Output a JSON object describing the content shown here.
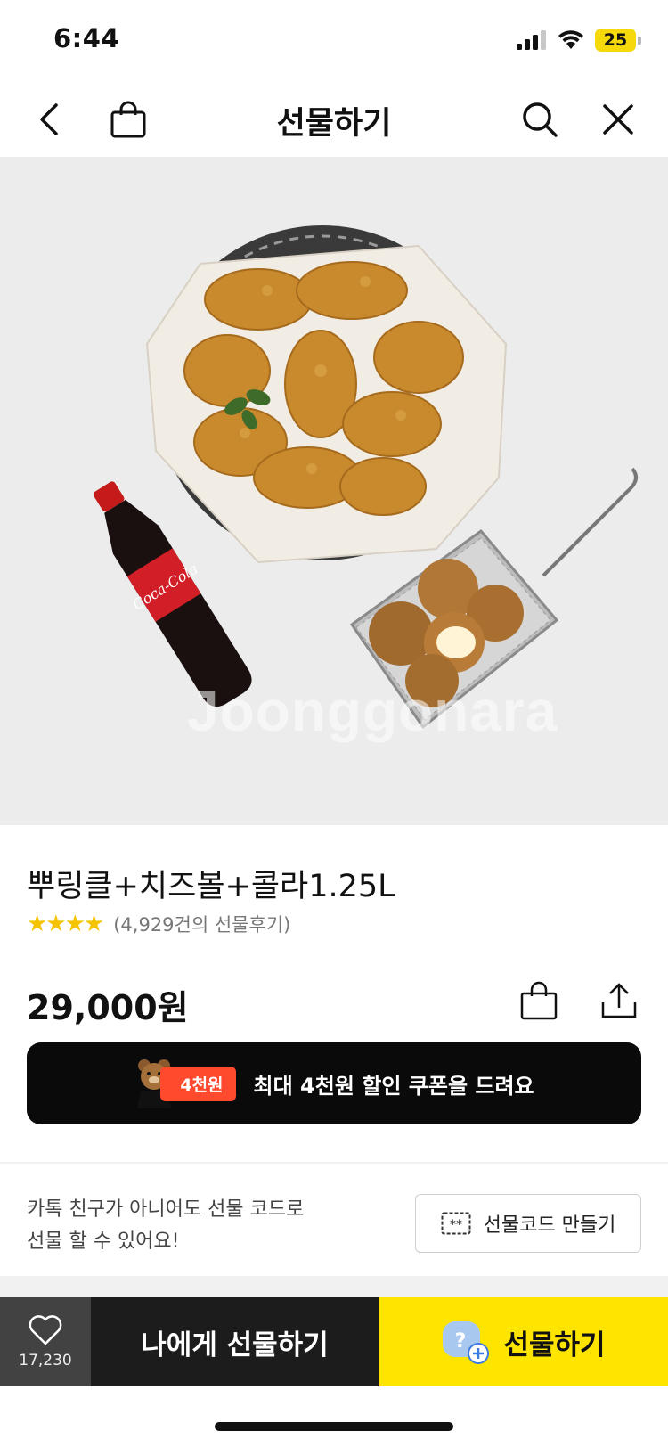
{
  "status_bar": {
    "time": "6:44",
    "battery": "25"
  },
  "header": {
    "title": "선물하기"
  },
  "hero": {
    "watermark": "Joonggonara"
  },
  "product": {
    "name": "뿌링클+치즈볼+콜라1.25L",
    "stars": "★★★★",
    "review_count": "(4,929건의 선물후기)",
    "price": "29,000원"
  },
  "coupon": {
    "badge": "4천원",
    "text": "최대 4천원 할인 쿠폰을 드려요"
  },
  "gift_code": {
    "line1": "카톡 친구가 아니어도 선물 코드로",
    "line2": "선물 할 수 있어요!",
    "button_label": "선물코드 만들기",
    "button_icon_text": "**"
  },
  "bottom_bar": {
    "like_count": "17,230",
    "self_gift_label": "나에게 선물하기",
    "gift_label": "선물하기"
  },
  "colors": {
    "accent_yellow": "#fee500",
    "coupon_red": "#ff4a2e",
    "star": "#f5c400"
  }
}
